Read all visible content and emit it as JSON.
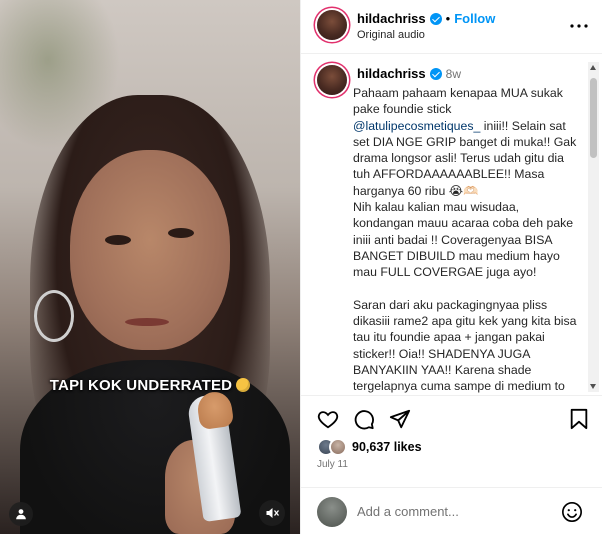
{
  "video": {
    "caption_text": "TAPI KOK UNDERRATED",
    "caption_emoji": "thinking-face",
    "icons": {
      "user_tag": "user-icon",
      "mute": "speaker-muted-icon"
    }
  },
  "header": {
    "username": "hildachriss",
    "separator": "•",
    "follow_label": "Follow",
    "audio_label": "Original audio",
    "verified_color": "#0095f6",
    "follow_color": "#0095f6"
  },
  "comment": {
    "username": "hildachriss",
    "time": "8w",
    "line1": "Pahaam pahaam kenapaa MUA sukak pake foundie stick ",
    "mention": "@latulipecosmetiques_",
    "line2": " iniii!! Selain sat set DIA NGE GRIP banget di muka!! Gak drama longsor asli! Terus udah gitu dia tuh AFFORDAAAAAABLEE!! Masa harganya 60 ribu 😭🫶🏻\nNih kalau kalian mau wisudaa, kondangan mauu acaraa coba deh pake iniii anti badai !! Coveragenyaa BISA BANGET DIBUILD mau medium hayo mau FULL COVERGAE juga ayo!\n\nSaran dari aku packagingnyaa pliss dikasiii rame2 apa gitu kek yang kita bisa tau itu foundie apaa + jangan pakai sticker!! Oia!! SHADENYA JUGA BANYAKIIN YAA!! Karena shade tergelapnya cuma sampe di medium to"
  },
  "actions": {
    "like_icon": "heart-icon",
    "comment_icon": "comment-icon",
    "share_icon": "share-icon",
    "save_icon": "bookmark-icon",
    "likes_count": "90,637",
    "likes_suffix": "likes",
    "date": "July 11"
  },
  "add_comment": {
    "placeholder": "Add a comment...",
    "emoji_icon": "emoji-icon"
  }
}
